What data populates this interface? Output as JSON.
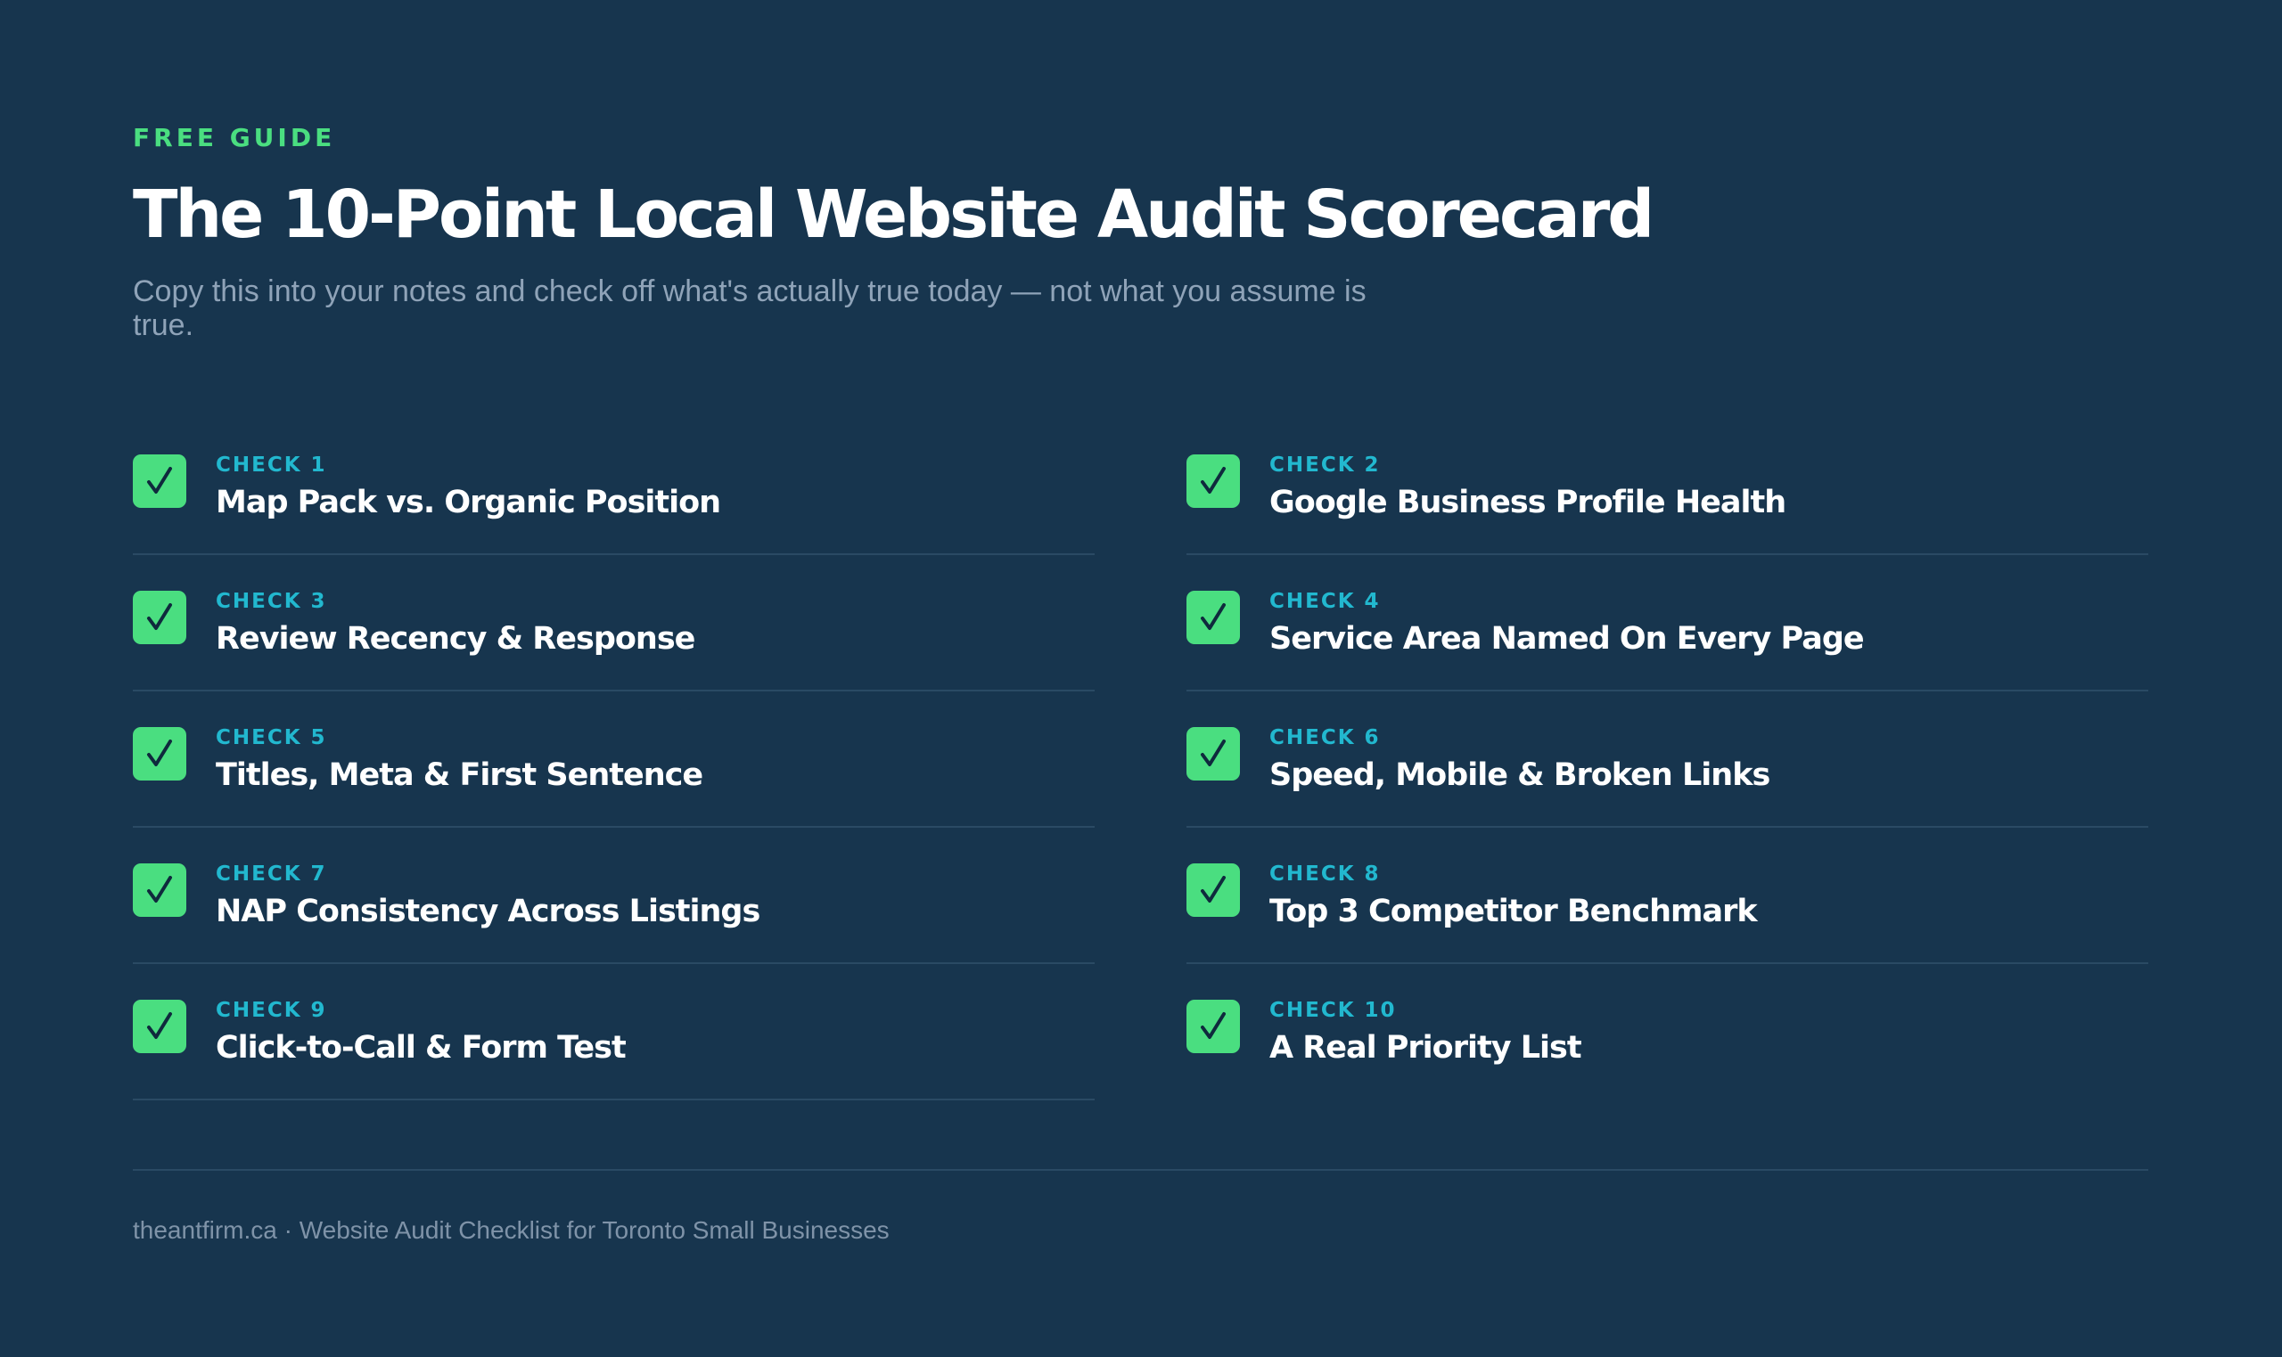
{
  "header": {
    "eyebrow": "FREE GUIDE",
    "title": "The 10-Point Local Website Audit Scorecard",
    "subtitle": "Copy this into your notes and check off what's actually true today — not what you assume is true."
  },
  "checks": [
    {
      "label": "CHECK 1",
      "title": "Map Pack vs. Organic Position",
      "checked": true
    },
    {
      "label": "CHECK 2",
      "title": "Google Business Profile Health",
      "checked": true
    },
    {
      "label": "CHECK 3",
      "title": "Review Recency & Response",
      "checked": true
    },
    {
      "label": "CHECK 4",
      "title": "Service Area Named On Every Page",
      "checked": true
    },
    {
      "label": "CHECK 5",
      "title": "Titles, Meta & First Sentence",
      "checked": true
    },
    {
      "label": "CHECK 6",
      "title": "Speed, Mobile & Broken Links",
      "checked": true
    },
    {
      "label": "CHECK 7",
      "title": "NAP Consistency Across Listings",
      "checked": true
    },
    {
      "label": "CHECK 8",
      "title": "Top 3 Competitor Benchmark",
      "checked": true
    },
    {
      "label": "CHECK 9",
      "title": "Click-to-Call & Form Test",
      "checked": true
    },
    {
      "label": "CHECK 10",
      "title": "A Real Priority List",
      "checked": true
    }
  ],
  "footer": {
    "text": "theantfirm.ca · Website Audit Checklist for Toronto Small Businesses"
  },
  "colors": {
    "background": "#17354e",
    "accent_green": "#4ade80",
    "accent_cyan": "#22b8cf",
    "divider": "#2a4a64"
  },
  "icons": {
    "check": "checkmark-icon"
  }
}
